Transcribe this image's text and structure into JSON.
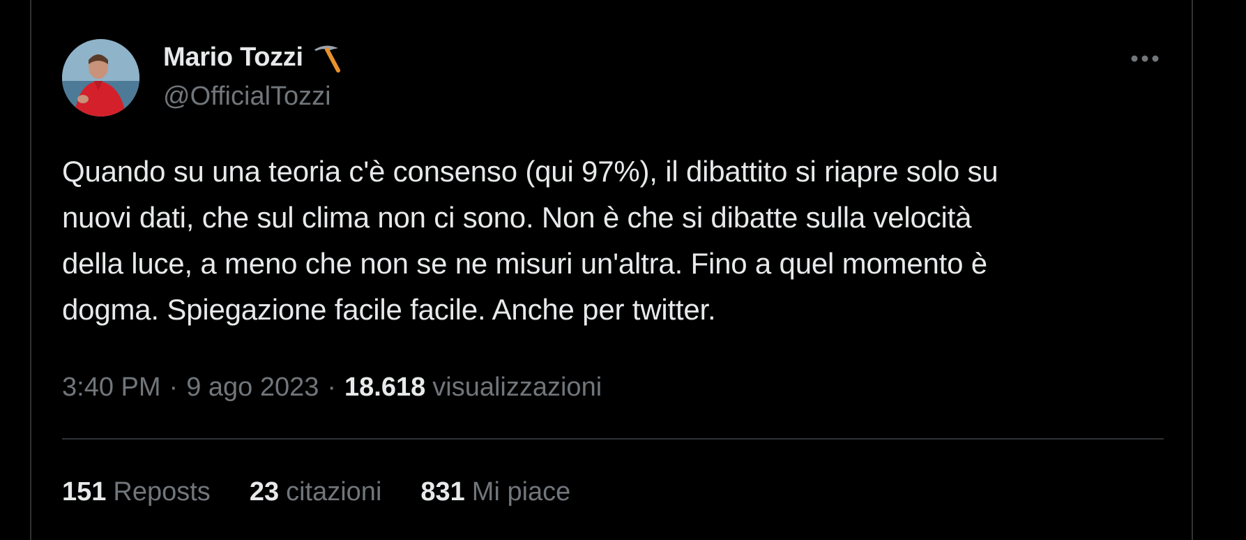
{
  "tweet": {
    "author": {
      "display_name": "Mario Tozzi",
      "badge_icon": "pickaxe-icon",
      "handle": "@OfficialTozzi"
    },
    "more_icon": "more-dots-icon",
    "text": "Quando su una teoria c'è consenso (qui 97%), il dibattito si riapre solo su\nnuovi dati, che sul clima non ci sono. Non è che si dibatte sulla velocità\ndella luce, a meno che non se ne misuri un'altra. Fino a quel momento è\ndogma. Spiegazione facile facile. Anche per twitter.",
    "time": "3:40 PM",
    "date": "9 ago 2023",
    "separator": "·",
    "views_count": "18.618",
    "views_label": "visualizzazioni",
    "stats": {
      "reposts_count": "151",
      "reposts_label": "Reposts",
      "quotes_count": "23",
      "quotes_label": "citazioni",
      "likes_count": "831",
      "likes_label": "Mi piace"
    }
  },
  "colors": {
    "background": "#000000",
    "primary_text": "#e7e9ea",
    "secondary_text": "#71767b",
    "divider": "#2f3336"
  }
}
